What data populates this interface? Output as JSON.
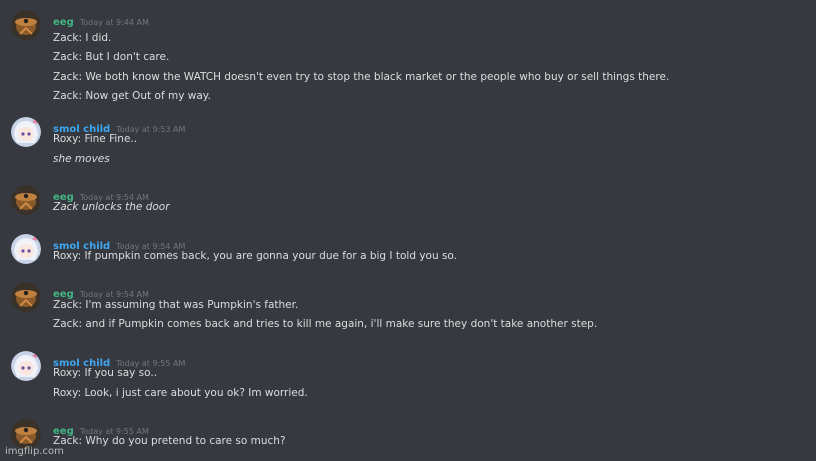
{
  "groups": [
    {
      "user": "eeg",
      "time": "Today at 9:44 AM",
      "color": "#43b581",
      "avatar": "brown-bird-icon",
      "messages": [
        {
          "text": "Zack: I did.",
          "italic": false
        },
        {
          "text": "Zack: But I don't care.",
          "italic": false
        },
        {
          "text": "Zack: We both know the WATCH doesn't even try to stop the black market or the people who buy or sell things there.",
          "italic": false
        },
        {
          "text": "Zack: Now get Out of my way.",
          "italic": false
        }
      ]
    },
    {
      "user": "smol child",
      "time": "Today at 9:53 AM",
      "color": "#3fa7f2",
      "avatar": "anime-girl-icon",
      "messages": [
        {
          "text": "Roxy: Fine Fine..",
          "italic": false
        },
        {
          "text": "she moves",
          "italic": true
        }
      ]
    },
    {
      "user": "eeg",
      "time": "Today at 9:54 AM",
      "color": "#43b581",
      "avatar": "brown-bird-icon",
      "messages": [
        {
          "text": "Zack unlocks the door",
          "italic": true
        }
      ]
    },
    {
      "user": "smol child",
      "time": "Today at 9:54 AM",
      "color": "#3fa7f2",
      "avatar": "anime-girl-icon",
      "messages": [
        {
          "text": "Roxy: If pumpkin comes back, you are gonna your due for a big I told you so.",
          "italic": false
        }
      ]
    },
    {
      "user": "eeg",
      "time": "Today at 9:54 AM",
      "color": "#43b581",
      "avatar": "brown-bird-icon",
      "messages": [
        {
          "text": "Zack: I'm assuming that was Pumpkin's father.",
          "italic": false
        },
        {
          "text": "Zack: and if Pumpkin comes back and tries to kill me again, i'll make sure they don't take another step.",
          "italic": false
        }
      ]
    },
    {
      "user": "smol child",
      "time": "Today at 9:55 AM",
      "color": "#3fa7f2",
      "avatar": "anime-girl-icon",
      "messages": [
        {
          "text": "Roxy: If you say so..",
          "italic": false
        },
        {
          "text": "Roxy: Look, i just care about you ok? Im worried.",
          "italic": false
        }
      ]
    },
    {
      "user": "eeg",
      "time": "Today at 9:55 AM",
      "color": "#43b581",
      "avatar": "brown-bird-icon",
      "messages": [
        {
          "text": "Zack: Why do you pretend to care so much?",
          "italic": false
        }
      ]
    }
  ],
  "watermark": "imgflip.com"
}
